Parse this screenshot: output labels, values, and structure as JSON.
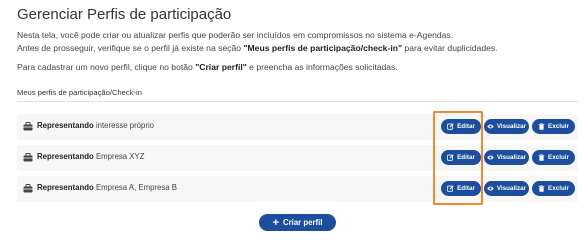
{
  "page": {
    "title": "Gerenciar Perfis de participação",
    "intro_line1": "Nesta tela, você pode criar ou atualizar perfis que poderão ser incluídos em compromissos no sistema e-Agendas.",
    "intro_line2_pre": "Antes de prosseguir, verifique se o perfil já existe na seção ",
    "intro_line2_bold": "\"Meus perfis de participação/check-in\"",
    "intro_line2_post": " para evitar duplicidades.",
    "intro_line3_pre": "Para cadastrar um novo perfil, clique no botão ",
    "intro_line3_bold": "\"Criar perfil\"",
    "intro_line3_post": " e preencha as informações solicitadas."
  },
  "section": {
    "label": "Meus perfis de participação/Check-in"
  },
  "profiles": [
    {
      "prefix": "Representando",
      "name": "interesse próprio"
    },
    {
      "prefix": "Representando",
      "name": "Empresa XYZ"
    },
    {
      "prefix": "Representando",
      "name": "Empresa A, Empresa B"
    }
  ],
  "actions": {
    "edit": "Editar",
    "view": "Visualizar",
    "delete": "Excluir"
  },
  "create_button": {
    "label": "Criar perfil"
  },
  "colors": {
    "primary": "#1d4e9e",
    "highlight": "#ef8a32"
  },
  "icons": {
    "profile": "briefcase-icon",
    "edit": "edit-icon",
    "view": "eye-icon",
    "delete": "trash-icon",
    "create": "plus-icon"
  }
}
